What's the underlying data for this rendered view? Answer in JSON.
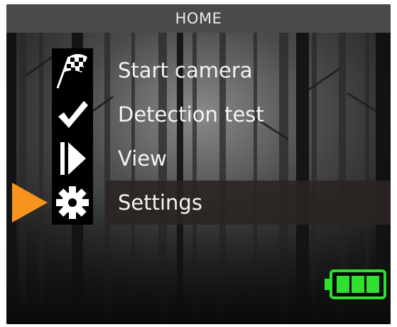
{
  "header": {
    "title": "HOME"
  },
  "menu": {
    "items": [
      {
        "label": "Start camera",
        "icon": "checkered-flag-icon",
        "selected": false
      },
      {
        "label": "Detection test",
        "icon": "checkmark-icon",
        "selected": false
      },
      {
        "label": "View",
        "icon": "play-icon",
        "selected": false
      },
      {
        "label": "Settings",
        "icon": "gear-icon",
        "selected": true
      }
    ]
  },
  "selection_pointer": {
    "icon": "triangle-pointer-icon",
    "color": "#f7931e"
  },
  "battery": {
    "icon": "battery-icon",
    "level_bars": 3,
    "max_bars": 3,
    "color": "#2fe02f"
  },
  "colors": {
    "header_bg": "#4a4a4a",
    "text": "#f4f4f4",
    "selected_row_bg": "#2a2422",
    "accent": "#f7931e"
  }
}
